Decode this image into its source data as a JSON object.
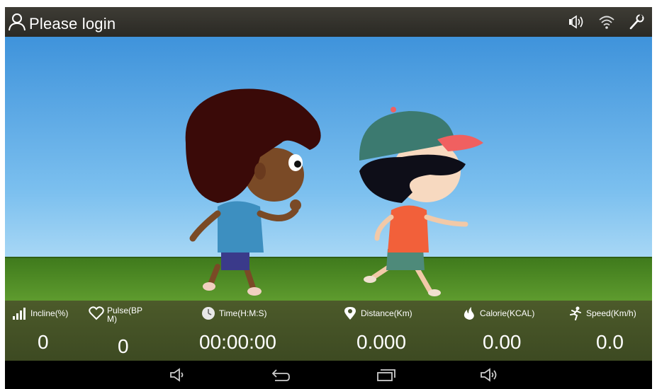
{
  "status_bar": {
    "login_text": "Please login",
    "icons": [
      "user-icon",
      "volume-icon",
      "wifi-icon",
      "settings-wrench-icon"
    ]
  },
  "metrics": {
    "incline": {
      "label": "Incline(%)",
      "value": "0",
      "icon": "incline-bars-icon"
    },
    "pulse": {
      "label_line1": "Pulse(BP",
      "label_line2": "M)",
      "value": "0",
      "icon": "heart-icon"
    },
    "time": {
      "label": "Time(H:M:S)",
      "value": "00:00:00",
      "icon": "clock-icon"
    },
    "distance": {
      "label": "Distance(Km)",
      "value": "0.000",
      "icon": "location-pin-icon"
    },
    "calorie": {
      "label": "Calorie(KCAL)",
      "value": "0.00",
      "icon": "flame-icon"
    },
    "speed": {
      "label": "Speed(Km/h)",
      "value": "0.0",
      "icon": "runner-icon"
    }
  },
  "nav_bar": {
    "buttons": [
      "volume-down-icon",
      "back-icon",
      "recent-apps-icon",
      "volume-up-icon"
    ]
  },
  "colors": {
    "status_bar_bg": "#2f2e28",
    "sky": "#5aa9e6",
    "grass": "#4e8a25",
    "metrics_bg": "#45522a",
    "nav_bg": "#000000"
  }
}
